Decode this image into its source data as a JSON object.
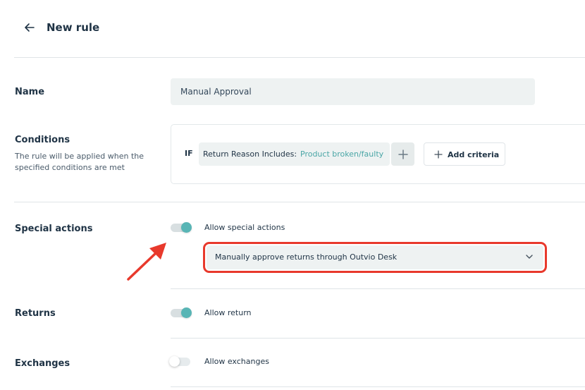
{
  "header": {
    "title": "New rule",
    "back_icon": "arrow-left-icon"
  },
  "name_section": {
    "label": "Name",
    "value": "Manual Approval"
  },
  "conditions": {
    "label": "Conditions",
    "description": "The rule will be applied when the specified conditions are met",
    "if_label": "IF",
    "criteria_key": "Return Reason Includes:",
    "criteria_value": "Product broken/faulty",
    "add_criteria_label": "Add criteria"
  },
  "special_actions": {
    "label": "Special actions",
    "toggle_label": "Allow special actions",
    "toggle_on": true,
    "selected_action": "Manually approve returns through Outvio Desk"
  },
  "returns": {
    "label": "Returns",
    "toggle_label": "Allow return",
    "toggle_on": true
  },
  "exchanges": {
    "label": "Exchanges",
    "toggle_label": "Allow exchanges",
    "toggle_on": false
  },
  "colors": {
    "accent": "#58b5b5",
    "criteria_value": "#4aa6a6",
    "highlight": "#e8392c",
    "text": "#1f3345"
  }
}
